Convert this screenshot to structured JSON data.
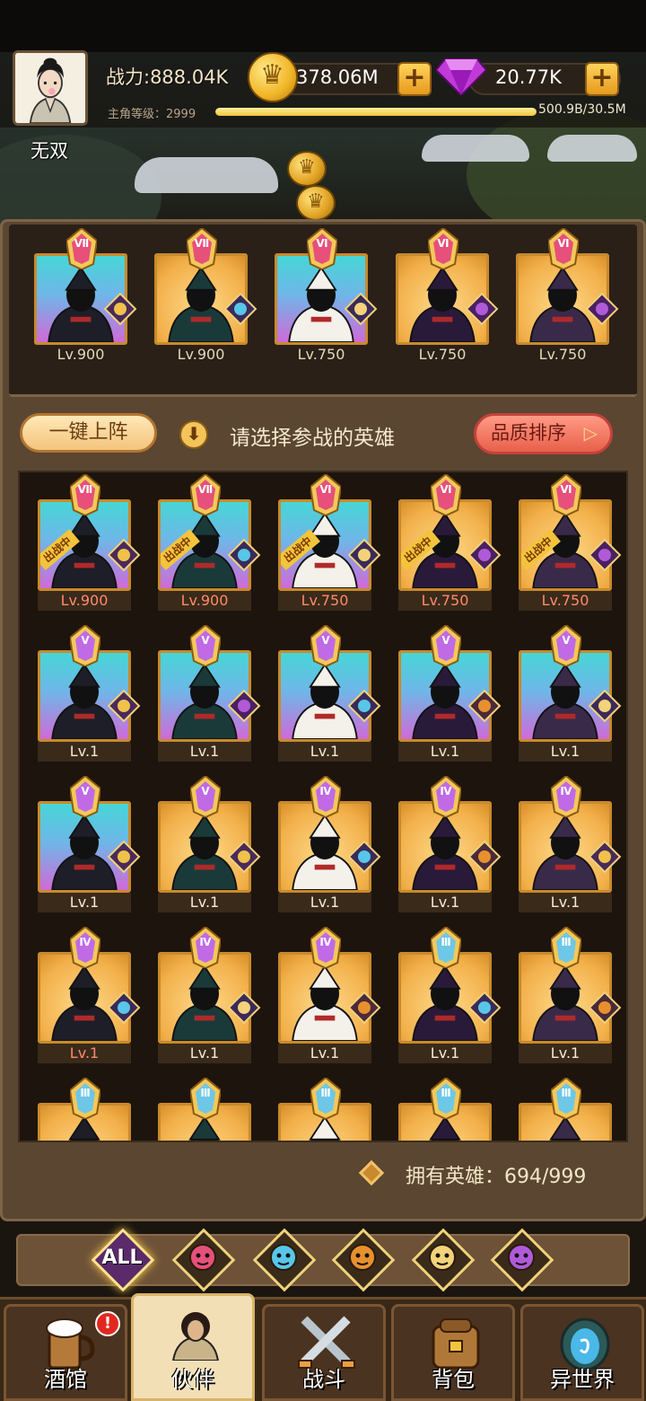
{
  "player": {
    "name": "无双",
    "power": "战力:888.04K",
    "level_label": "主角等级：2999",
    "exp_text": "500.9B/30.5M",
    "exp_progress": 1.0
  },
  "resources": {
    "gold": "378.06M",
    "gems": "20.77K"
  },
  "team": [
    {
      "rank": "Ⅶ",
      "level": "Lv.900",
      "bg": "cyan",
      "element": "crown"
    },
    {
      "rank": "Ⅶ",
      "level": "Lv.900",
      "bg": "gold",
      "element": "water"
    },
    {
      "rank": "Ⅵ",
      "level": "Lv.750",
      "bg": "cyan",
      "element": "elf"
    },
    {
      "rank": "Ⅵ",
      "level": "Lv.750",
      "bg": "gold",
      "element": "demon"
    },
    {
      "rank": "Ⅵ",
      "level": "Lv.750",
      "bg": "gold",
      "element": "demon"
    }
  ],
  "controls": {
    "one_key_label": "一键上阵",
    "hint": "请选择参战的英雄",
    "sort_label": "品质排序"
  },
  "hero_list": [
    {
      "rank": "Ⅶ",
      "level": "Lv.900",
      "bg": "cyan",
      "element": "crown",
      "deployed": true
    },
    {
      "rank": "Ⅶ",
      "level": "Lv.900",
      "bg": "cyan",
      "element": "water",
      "deployed": true
    },
    {
      "rank": "Ⅵ",
      "level": "Lv.750",
      "bg": "cyan",
      "element": "elf",
      "deployed": true
    },
    {
      "rank": "Ⅵ",
      "level": "Lv.750",
      "bg": "gold",
      "element": "demon",
      "deployed": true
    },
    {
      "rank": "Ⅵ",
      "level": "Lv.750",
      "bg": "gold",
      "element": "demon",
      "deployed": true
    },
    {
      "rank": "Ⅴ",
      "level": "Lv.1",
      "bg": "cyan",
      "element": "crown"
    },
    {
      "rank": "Ⅴ",
      "level": "Lv.1",
      "bg": "cyan",
      "element": "demon"
    },
    {
      "rank": "Ⅴ",
      "level": "Lv.1",
      "bg": "cyan",
      "element": "water"
    },
    {
      "rank": "Ⅴ",
      "level": "Lv.1",
      "bg": "cyan",
      "element": "beast"
    },
    {
      "rank": "Ⅴ",
      "level": "Lv.1",
      "bg": "cyan",
      "element": "elf"
    },
    {
      "rank": "Ⅴ",
      "level": "Lv.1",
      "bg": "cyan",
      "element": "crown"
    },
    {
      "rank": "Ⅴ",
      "level": "Lv.1",
      "bg": "gold",
      "element": "crown"
    },
    {
      "rank": "Ⅳ",
      "level": "Lv.1",
      "bg": "gold",
      "element": "water"
    },
    {
      "rank": "Ⅳ",
      "level": "Lv.1",
      "bg": "gold",
      "element": "beast"
    },
    {
      "rank": "Ⅳ",
      "level": "Lv.1",
      "bg": "gold",
      "element": "crown"
    },
    {
      "rank": "Ⅳ",
      "level": "Lv.1",
      "bg": "gold",
      "element": "water",
      "red": true
    },
    {
      "rank": "Ⅳ",
      "level": "Lv.1",
      "bg": "gold",
      "element": "elf"
    },
    {
      "rank": "Ⅳ",
      "level": "Lv.1",
      "bg": "gold",
      "element": "beast"
    },
    {
      "rank": "Ⅲ",
      "level": "Lv.1",
      "bg": "gold",
      "element": "water"
    },
    {
      "rank": "Ⅲ",
      "level": "Lv.1",
      "bg": "gold",
      "element": "beast"
    },
    {
      "rank": "Ⅲ",
      "level": "",
      "bg": "gold",
      "element": ""
    },
    {
      "rank": "Ⅲ",
      "level": "",
      "bg": "gold",
      "element": ""
    },
    {
      "rank": "Ⅲ",
      "level": "",
      "bg": "gold",
      "element": ""
    },
    {
      "rank": "Ⅲ",
      "level": "",
      "bg": "gold",
      "element": ""
    },
    {
      "rank": "Ⅲ",
      "level": "",
      "bg": "gold",
      "element": ""
    }
  ],
  "deployed_tag": "出战中",
  "owned": {
    "label": "拥有英雄：694/999"
  },
  "filters": [
    {
      "label": "ALL",
      "icon": "all",
      "active": true
    },
    {
      "label": "",
      "icon": "crown-faction-icon"
    },
    {
      "label": "",
      "icon": "water-faction-icon"
    },
    {
      "label": "",
      "icon": "beast-faction-icon"
    },
    {
      "label": "",
      "icon": "elf-faction-icon"
    },
    {
      "label": "",
      "icon": "demon-faction-icon"
    }
  ],
  "nav": [
    {
      "label": "酒馆",
      "icon": "beer-mug-icon",
      "badge": "!"
    },
    {
      "label": "伙伴",
      "icon": "partner-icon",
      "active": true
    },
    {
      "label": "战斗",
      "icon": "crossed-swords-icon"
    },
    {
      "label": "背包",
      "icon": "backpack-icon"
    },
    {
      "label": "异世界",
      "icon": "portal-icon"
    }
  ],
  "colors": {
    "panel": "#5a4631",
    "gold_accent": "#f3c43b",
    "sort_button": "#e8604a",
    "cyan_quality": "#46d6d6",
    "gold_quality": "#f2b04a"
  }
}
